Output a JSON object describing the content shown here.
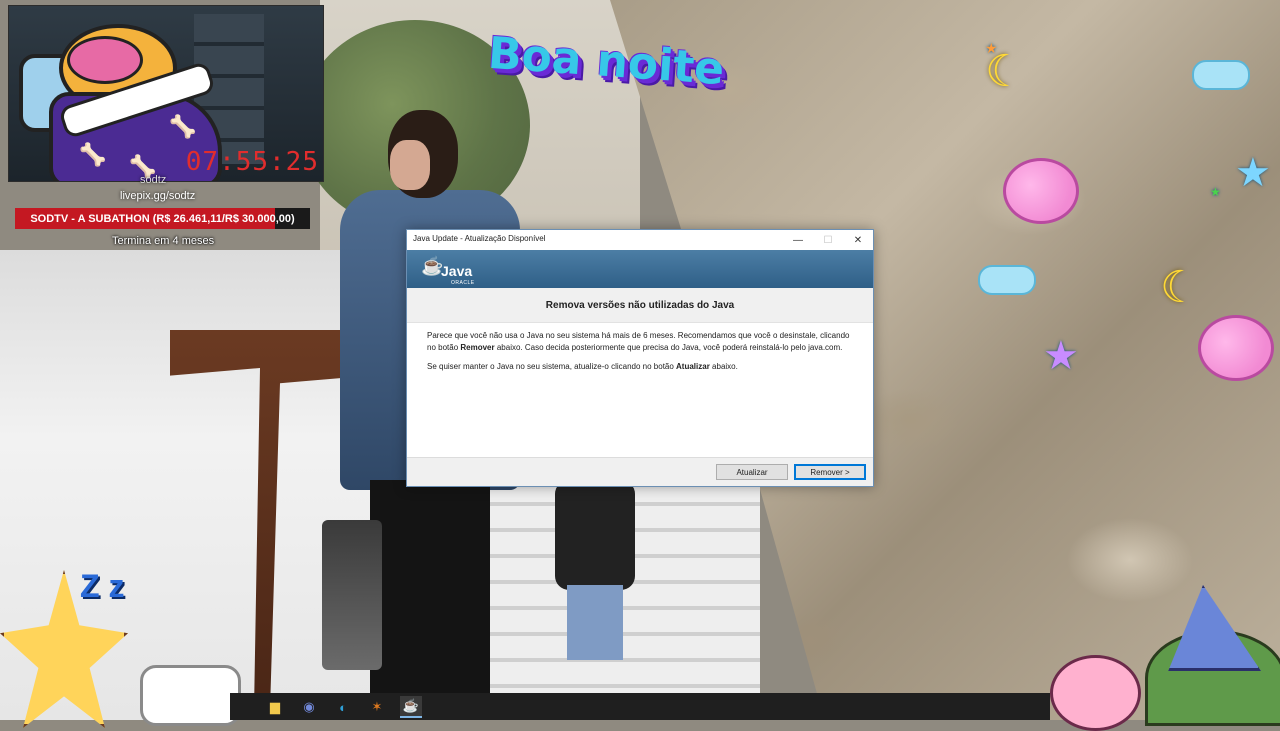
{
  "stream_overlay": {
    "webcam_timer": "07:55:25",
    "channel_name": "sodtz",
    "donation_url": "livepix.gg/sodtz",
    "subathon": {
      "label": "SODTV - A SUBATHON (R$ 26.461,11/R$ 30.000,00)",
      "progress": 0.882,
      "ends_in": "Termina em 4 meses"
    },
    "greeting": "Boa noite",
    "colors": {
      "subathon_fill": "#c41822",
      "greeting_text": "#37c8e8",
      "timer": "#e12d2d"
    }
  },
  "dialog": {
    "title": "Java Update - Atualização Disponível",
    "logo_text": "Java",
    "logo_subtext": "ORACLE",
    "headline": "Remova versões não utilizadas do Java",
    "paragraph1": {
      "part1": "Parece que você não usa o Java no seu sistema há mais de 6 meses. Recomendamos que você o desinstale, clicando no botão ",
      "bold": "Remover",
      "part2": " abaixo. Caso decida posteriormente que precisa do Java, você poderá reinstalá-lo pelo java.com."
    },
    "paragraph2": {
      "part1": "Se quiser manter o Java no seu sistema, atualize-o clicando no botão ",
      "bold": "Atualizar",
      "part2": " abaixo."
    },
    "buttons": {
      "update": "Atualizar",
      "remove": "Remover >"
    },
    "window_controls": {
      "minimize": "—",
      "maximize": "☐",
      "close": "✕"
    }
  },
  "taskbar": {
    "icons": [
      {
        "name": "file-explorer-icon",
        "glyph": "▆",
        "color": "#f2c94c"
      },
      {
        "name": "discord-icon",
        "glyph": "◉",
        "color": "#7289da"
      },
      {
        "name": "edge-icon",
        "glyph": "◐",
        "color": "#2fa0d8"
      },
      {
        "name": "app-icon",
        "glyph": "✶",
        "color": "#e07a1f"
      },
      {
        "name": "java-taskbar-icon",
        "glyph": "☕",
        "color": "#e8e8e8"
      }
    ]
  }
}
